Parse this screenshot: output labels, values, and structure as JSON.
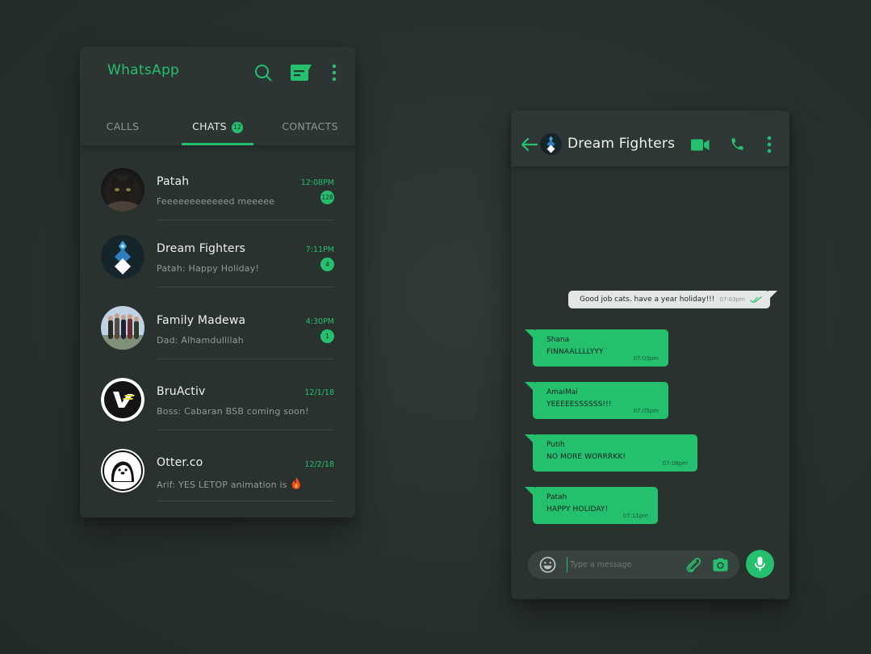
{
  "colors": {
    "accent": "#25c06e",
    "panel": "#2a3230",
    "background": "#28312f"
  },
  "list": {
    "app_title": "WhatsApp",
    "icons": [
      "search-icon",
      "new-chat-icon",
      "more-vert-icon"
    ],
    "tabs": [
      {
        "label": "CALLS"
      },
      {
        "label": "CHATS",
        "badge": "12",
        "active": true
      },
      {
        "label": "CONTACTS"
      }
    ],
    "chats": [
      {
        "name": "Patah",
        "preview": "Feeeeeeeeeeeed meeeee",
        "time": "12:08PM",
        "unread": "128",
        "avatar": "cat-photo"
      },
      {
        "name": "Dream Fighters",
        "preview": "Patah: Happy Holiday!",
        "time": "7:11PM",
        "unread": "4",
        "avatar": "dream-fighters-logo"
      },
      {
        "name": "Family Madewa",
        "preview": "Dad: Alhamdullilah",
        "time": "4:30PM",
        "unread": "1",
        "avatar": "family-photo"
      },
      {
        "name": "BruActiv",
        "preview": "Boss: Cabaran BSB coming soon!",
        "time": "12/1/18",
        "unread": null,
        "avatar": "bruactiv-logo"
      },
      {
        "name": "Otter.co",
        "preview": "Arif: YES LETOP animation is",
        "time": "12/2/18",
        "unread": null,
        "avatar": "otter-logo",
        "emoji": "fire-icon"
      }
    ]
  },
  "conversation": {
    "title": "Dream Fighters",
    "icons": [
      "back-arrow-icon",
      "video-call-icon",
      "phone-icon",
      "more-vert-icon"
    ],
    "outgoing": {
      "text": "Good job cats. have a year holiday!!!",
      "time": "07:03pm",
      "status": "double-check-icon"
    },
    "incoming": [
      {
        "sender": "Shana",
        "text": "FINNAALLLLYYY",
        "time": "07:03pm"
      },
      {
        "sender": "AmaiMai",
        "text": "YEEEEESSSSSS!!!",
        "time": "07:05pm"
      },
      {
        "sender": "Putih",
        "text": "NO MORE WORRRKK!",
        "time": "07:08pm"
      },
      {
        "sender": "Patah",
        "text": "HAPPY HOLIDAY!",
        "time": "07:11pm"
      }
    ],
    "composer": {
      "placeholder": "Type a message",
      "value": ""
    }
  }
}
